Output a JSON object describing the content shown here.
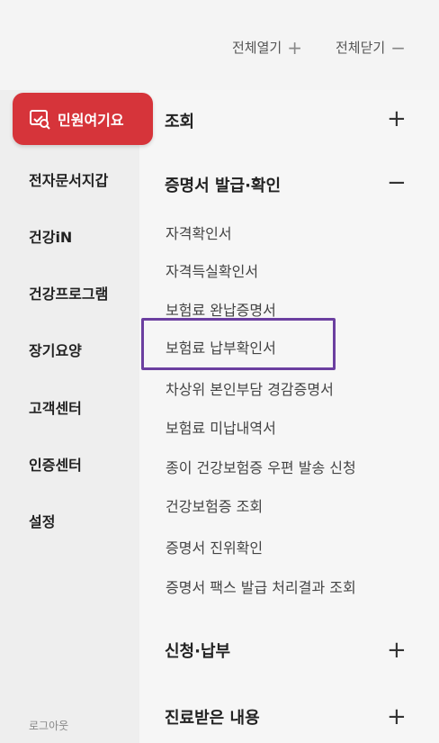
{
  "header": {
    "expand_all": "전체열기",
    "collapse_all": "전체닫기"
  },
  "sidebar": {
    "minwon_label": "민원여기요",
    "items": [
      {
        "label": "전자문서지갑"
      },
      {
        "label": "건강iN"
      },
      {
        "label": "건강프로그램"
      },
      {
        "label": "장기요양"
      },
      {
        "label": "고객센터"
      },
      {
        "label": "인증센터"
      },
      {
        "label": "설정"
      }
    ],
    "logout": "로그아웃"
  },
  "sections": [
    {
      "label": "조회",
      "toggle": "+"
    },
    {
      "label": "증명서 발급·확인",
      "toggle": "−"
    },
    {
      "label": "신청·납부",
      "toggle": "+"
    },
    {
      "label": "진료받은 내용",
      "toggle": "+"
    }
  ],
  "certificate_items": [
    {
      "label": "자격확인서"
    },
    {
      "label": "자격득실확인서"
    },
    {
      "label": "보험료 완납증명서"
    },
    {
      "label": "보험료 납부확인서"
    },
    {
      "label": "차상위 본인부담 경감증명서"
    },
    {
      "label": "보험료 미납내역서"
    },
    {
      "label": "종이 건강보험증 우편 발송 신청"
    },
    {
      "label": "건강보험증 조회"
    },
    {
      "label": "증명서 진위확인"
    },
    {
      "label": "증명서 팩스 발급 처리결과 조회"
    }
  ],
  "highlighted_item": "보험료 납부확인서",
  "colors": {
    "accent_red": "#d6343a",
    "highlight_purple": "#6b3fa0"
  }
}
